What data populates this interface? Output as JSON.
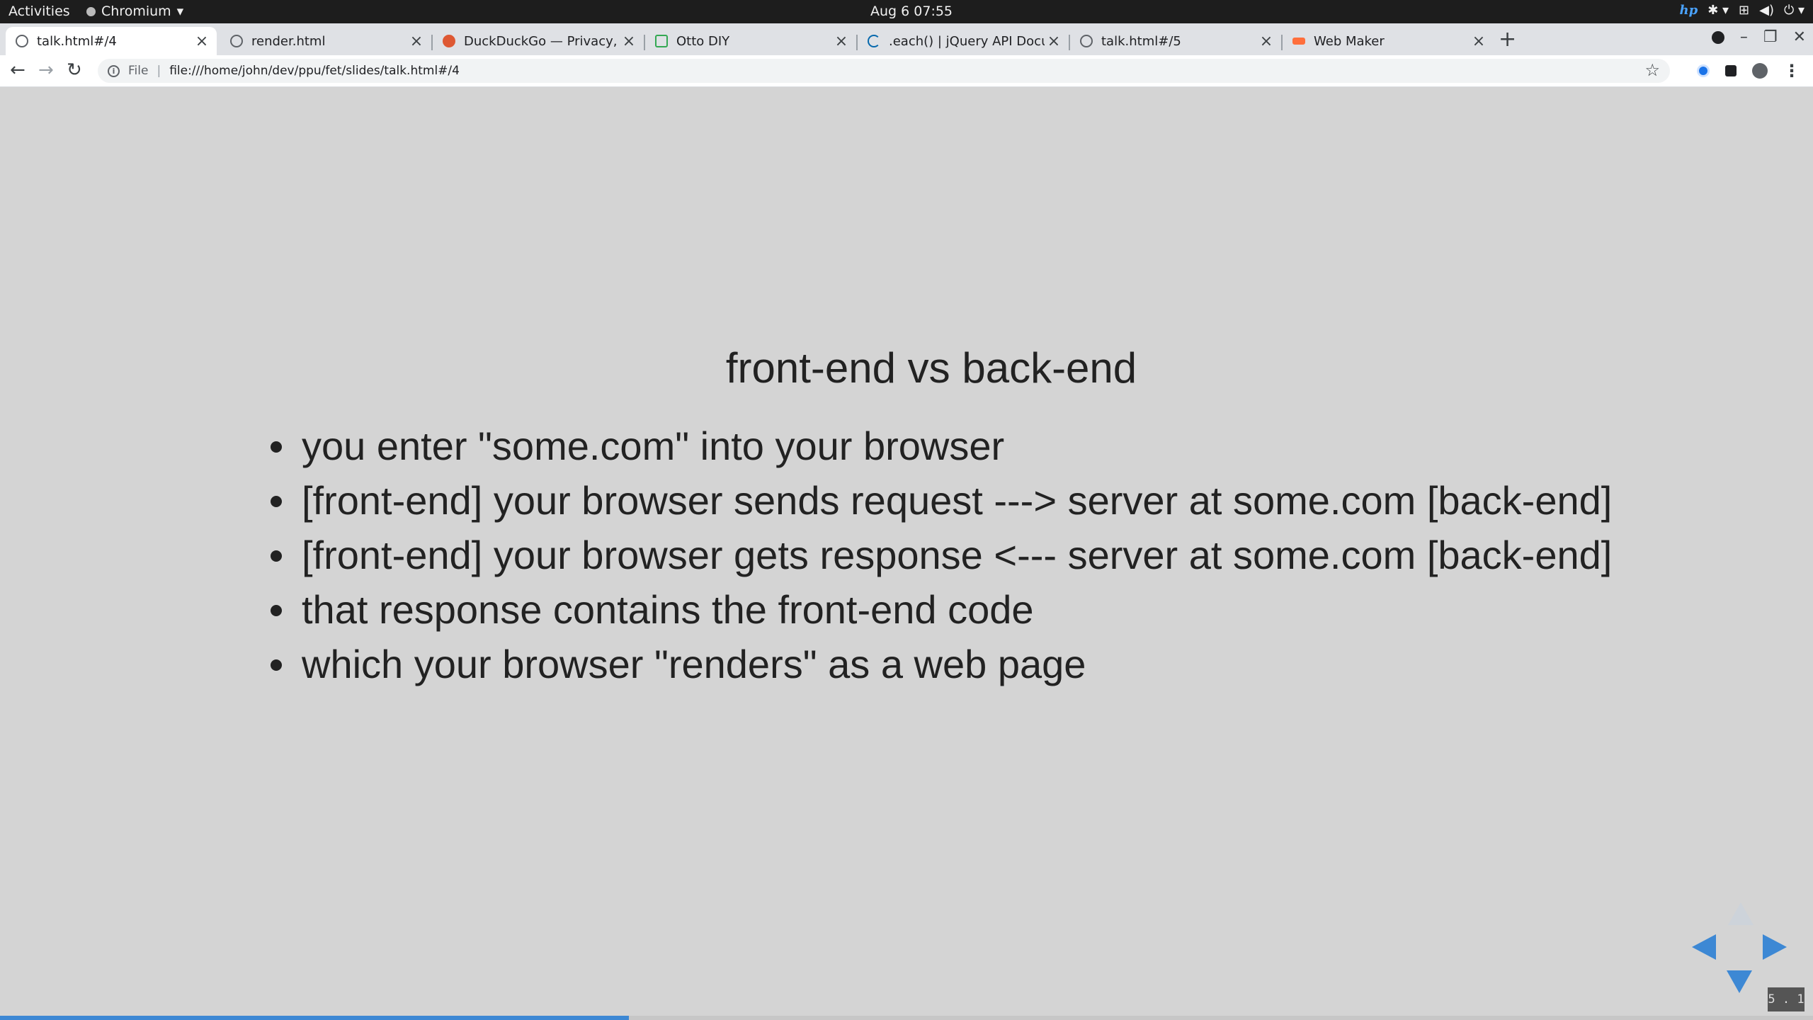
{
  "system_bar": {
    "activities": "Activities",
    "app_name": "Chromium",
    "clock": "Aug 6  07:55",
    "hp_label": "hp"
  },
  "tabs": [
    {
      "title": "talk.html#/4",
      "active": true
    },
    {
      "title": "render.html",
      "active": false
    },
    {
      "title": "DuckDuckGo — Privacy, s",
      "active": false
    },
    {
      "title": "Otto DIY",
      "active": false
    },
    {
      "title": ".each() | jQuery API Docu",
      "active": false
    },
    {
      "title": "talk.html#/5",
      "active": false
    },
    {
      "title": "Web Maker",
      "active": false
    }
  ],
  "toolbar": {
    "scheme_label": "File",
    "url": "file:///home/john/dev/ppu/fet/slides/talk.html#/4"
  },
  "slide": {
    "title": "front-end vs back-end",
    "bullets": [
      "you enter \"some.com\" into your browser",
      "[front-end] your browser sends request ---> server at some.com [back-end]",
      "[front-end] your browser gets response <--- server at some.com [back-end]",
      "that response contains the front-end code",
      "which your browser \"renders\" as a web page"
    ],
    "slide_number": "5 . 1",
    "progress_fraction": 0.347
  },
  "colors": {
    "accent": "#3d88d4",
    "slide_background": "#d4d4d4",
    "text": "#222222"
  }
}
